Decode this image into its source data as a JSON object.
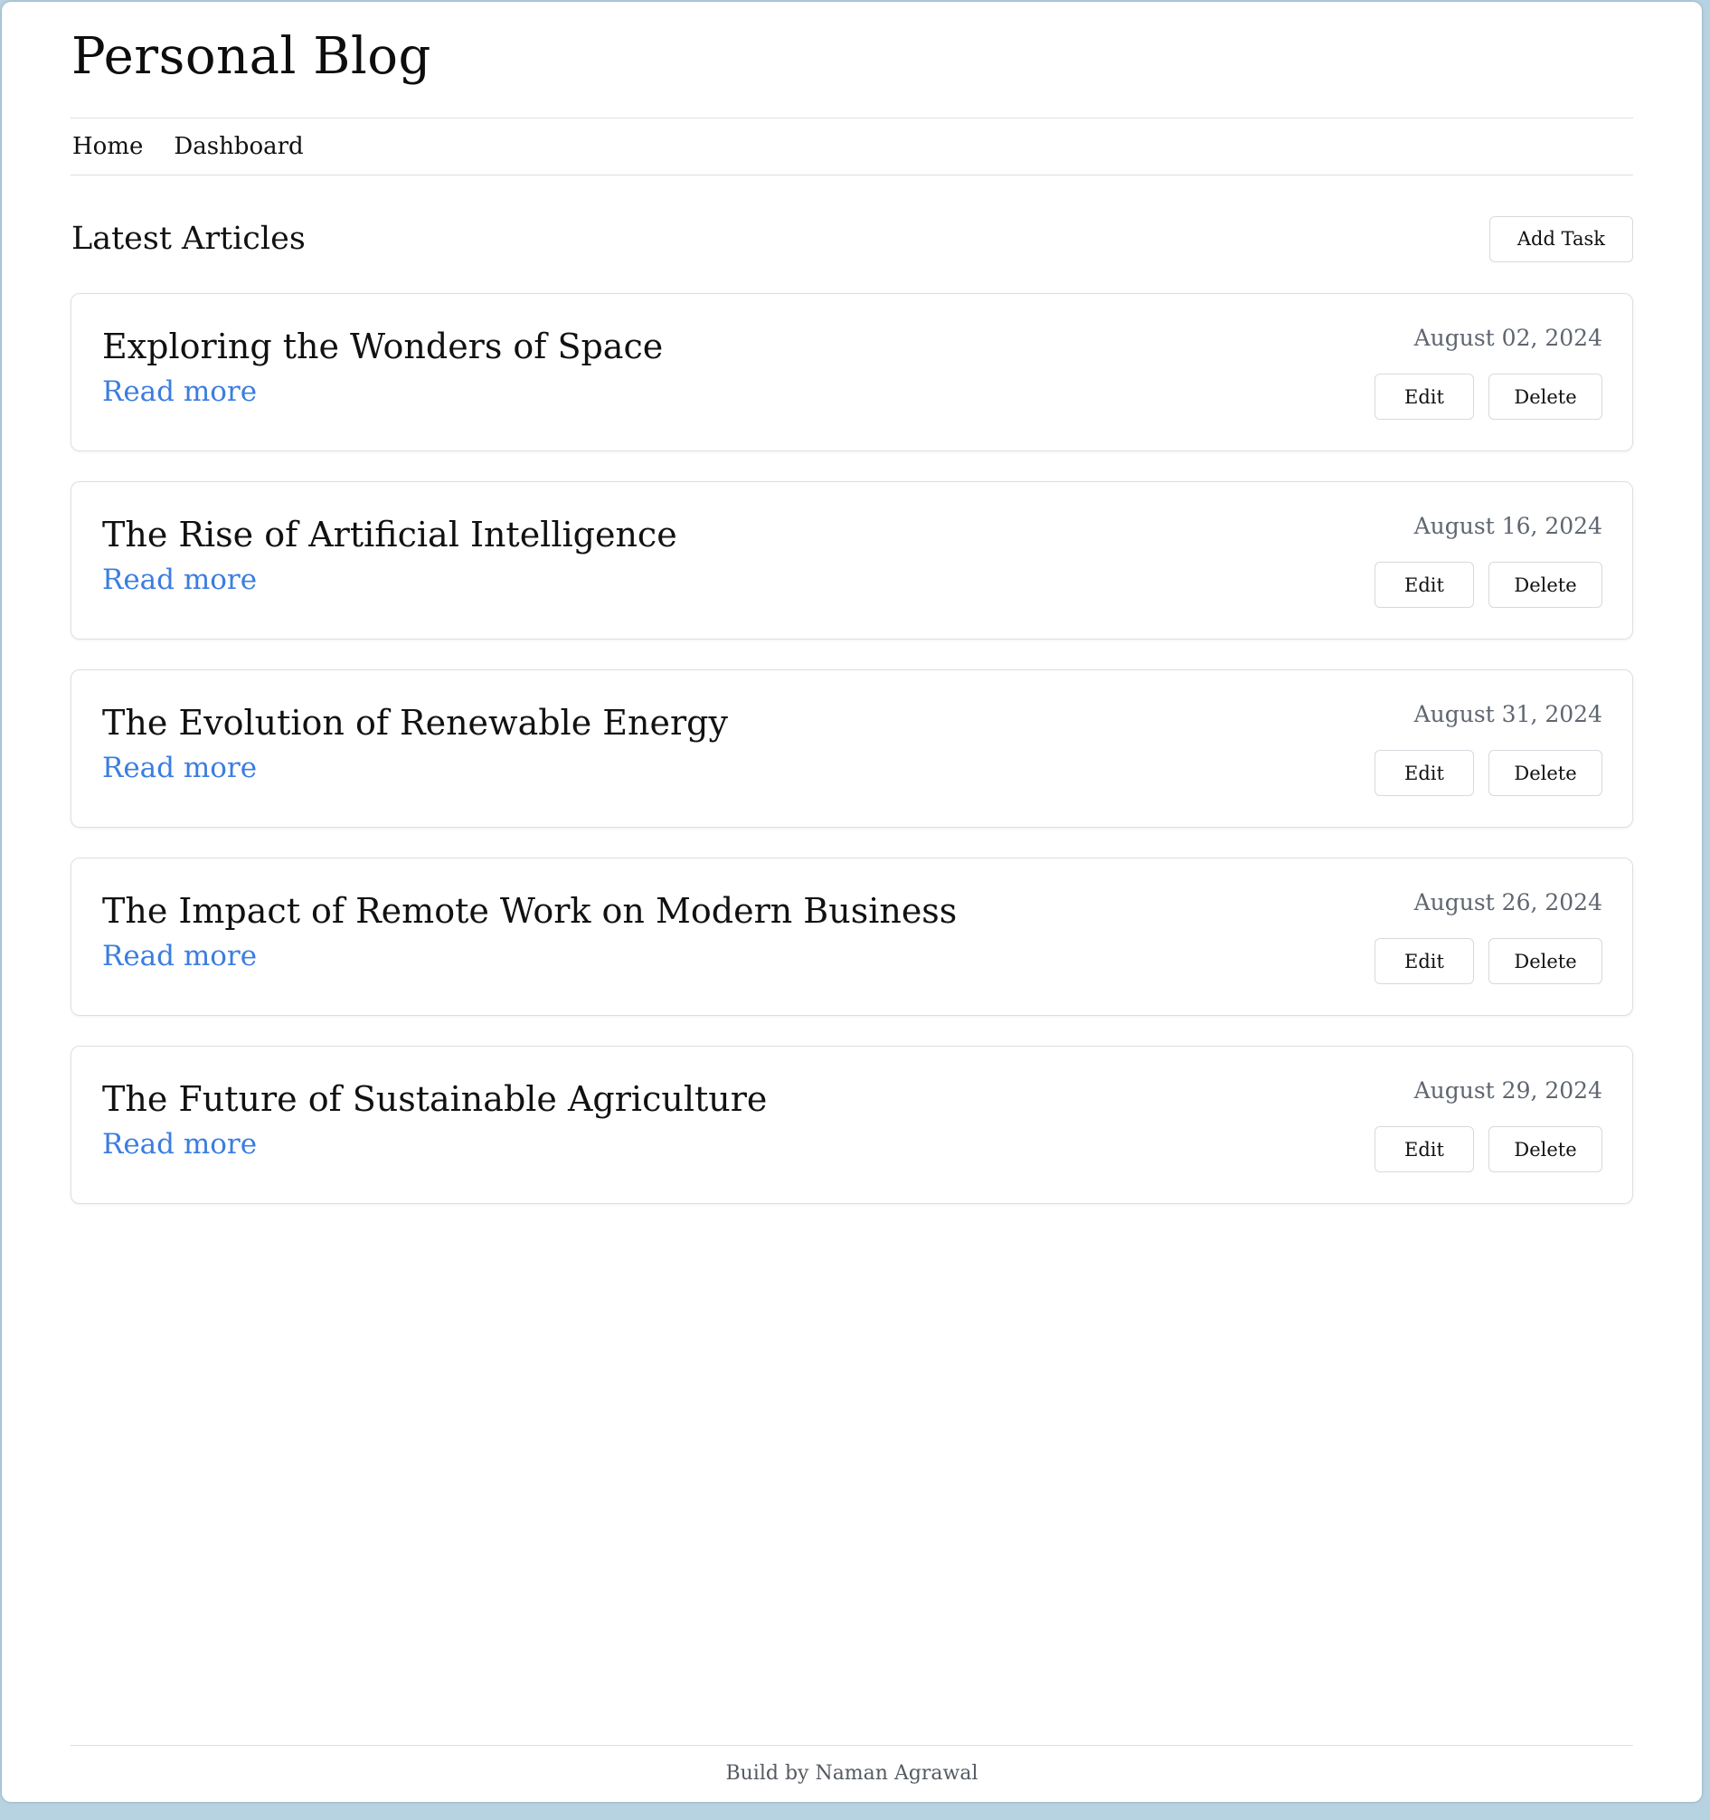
{
  "site": {
    "title": "Personal Blog"
  },
  "nav": {
    "items": [
      {
        "label": "Home"
      },
      {
        "label": "Dashboard"
      }
    ]
  },
  "main": {
    "section_title": "Latest Articles",
    "add_button_label": "Add Task",
    "articles": [
      {
        "title": "Exploring the Wonders of Space",
        "date": "August 02, 2024",
        "read_more": "Read more",
        "edit_label": "Edit",
        "delete_label": "Delete"
      },
      {
        "title": "The Rise of Artificial Intelligence",
        "date": "August 16, 2024",
        "read_more": "Read more",
        "edit_label": "Edit",
        "delete_label": "Delete"
      },
      {
        "title": "The Evolution of Renewable Energy",
        "date": "August 31, 2024",
        "read_more": "Read more",
        "edit_label": "Edit",
        "delete_label": "Delete"
      },
      {
        "title": "The Impact of Remote Work on Modern Business",
        "date": "August 26, 2024",
        "read_more": "Read more",
        "edit_label": "Edit",
        "delete_label": "Delete"
      },
      {
        "title": "The Future of Sustainable Agriculture",
        "date": "August 29, 2024",
        "read_more": "Read more",
        "edit_label": "Edit",
        "delete_label": "Delete"
      }
    ]
  },
  "footer": {
    "text": "Build by Naman Agrawal"
  },
  "colors": {
    "link": "#3b7de0",
    "date": "#5f6670",
    "border": "#dcdfe3",
    "page_background": "#b7d3e2"
  }
}
